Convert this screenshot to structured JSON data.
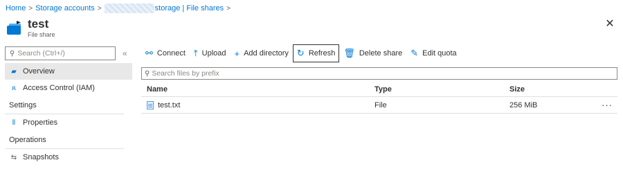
{
  "breadcrumb": {
    "home": "Home",
    "storage_accounts": "Storage accounts",
    "current": "storage | File shares",
    "separator": ">"
  },
  "header": {
    "title": "test",
    "subtitle": "File share",
    "close_icon": "close-icon"
  },
  "sidebar": {
    "search_placeholder": "Search (Ctrl+/)",
    "collapse": "«",
    "items": [
      {
        "label": "Overview",
        "icon": "file-share-icon",
        "active": true
      },
      {
        "label": "Access Control (IAM)",
        "icon": "people-icon",
        "active": false
      }
    ],
    "sections": [
      {
        "title": "Settings",
        "items": [
          {
            "label": "Properties",
            "icon": "properties-icon"
          }
        ]
      },
      {
        "title": "Operations",
        "items": [
          {
            "label": "Snapshots",
            "icon": "snapshots-icon"
          }
        ]
      }
    ]
  },
  "toolbar": {
    "connect": "Connect",
    "upload": "Upload",
    "add_directory": "Add directory",
    "refresh": "Refresh",
    "delete_share": "Delete share",
    "edit_quota": "Edit quota"
  },
  "files": {
    "search_placeholder": "Search files by prefix",
    "columns": {
      "name": "Name",
      "type": "Type",
      "size": "Size"
    },
    "rows": [
      {
        "name": "test.txt",
        "type": "File",
        "size": "256 MiB",
        "more": "···"
      }
    ]
  },
  "colors": {
    "accent": "#0078d4",
    "active_nav_bg": "#e8e8e8",
    "border": "#e1dfdd"
  }
}
